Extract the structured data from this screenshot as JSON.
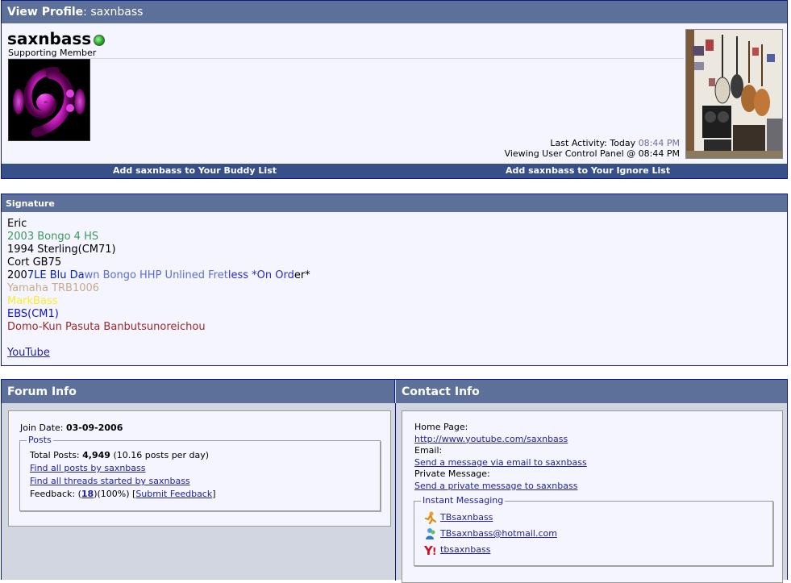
{
  "profile": {
    "header_label": "View Profile",
    "header_sep": ":",
    "header_user": "saxnbass",
    "username": "saxnbass",
    "user_title": "Supporting Member",
    "last_activity_label": "Last Activity: Today",
    "last_activity_time": "08:44 PM",
    "viewing": "Viewing User Control Panel @ 08:44 PM",
    "buddy_link": "Add saxnbass to Your Buddy List",
    "ignore_link": "Add saxnbass to Your Ignore List",
    "online_status_color": "#1ca11c"
  },
  "signature": {
    "header": "Signature",
    "lines": {
      "l1": "Eric",
      "l2": "2003 Bongo 4 HS",
      "l3": "1994 Sterling(CM71)",
      "l4": "Cort GB75",
      "l5_a": "200",
      "l5_b": "7LE Blu Da",
      "l5_c": "wn Bongo HHP Unlined Fret",
      "l5_d": "less *On Ord",
      "l5_e": "er*",
      "l6": "Yamaha TRB1006",
      "l7": "MarkBass",
      "l8": "EBS(CM1)",
      "l9": "Domo-Kun Pasuta Banbutsunoreichou",
      "l10": "YouTube"
    },
    "colors": {
      "green": "#3a9a5c",
      "blue_dark": "#0a20c8",
      "blue_mid": "#3c50d0",
      "blue_light": "#5a6ed8",
      "tan": "#c8aa8a",
      "yellow": "#ffea28",
      "blue": "#1010e0",
      "red": "#a02828"
    }
  },
  "forum_info": {
    "header": "Forum Info",
    "join_label": "Join Date:",
    "join_date": "03-09-2006",
    "posts_legend": "Posts",
    "total_posts_label": "Total Posts:",
    "total_posts": "4,949",
    "per_day": "(10.16 posts per day)",
    "find_posts": "Find all posts by saxnbass",
    "find_threads": "Find all threads started by saxnbass",
    "feedback_label": "Feedback: (",
    "feedback_count": "18",
    "feedback_pct": ")(100%) [",
    "submit_feedback": "Submit Feedback",
    "feedback_close": "]"
  },
  "contact_info": {
    "header": "Contact Info",
    "home_label": "Home Page:",
    "home_url": "http://www.youtube.com/saxnbass",
    "email_label": "Email:",
    "email_link": "Send a message via email to saxnbass",
    "pm_label": "Private Message:",
    "pm_link": "Send a private message to saxnbass",
    "im_legend": "Instant Messaging",
    "im": [
      {
        "icon": "aim-icon",
        "handle": "TBsaxnbass"
      },
      {
        "icon": "msn-icon",
        "handle": "TBsaxnbass@hotmail.com"
      },
      {
        "icon": "yahoo-icon",
        "handle": "tbsaxnbass"
      }
    ]
  }
}
